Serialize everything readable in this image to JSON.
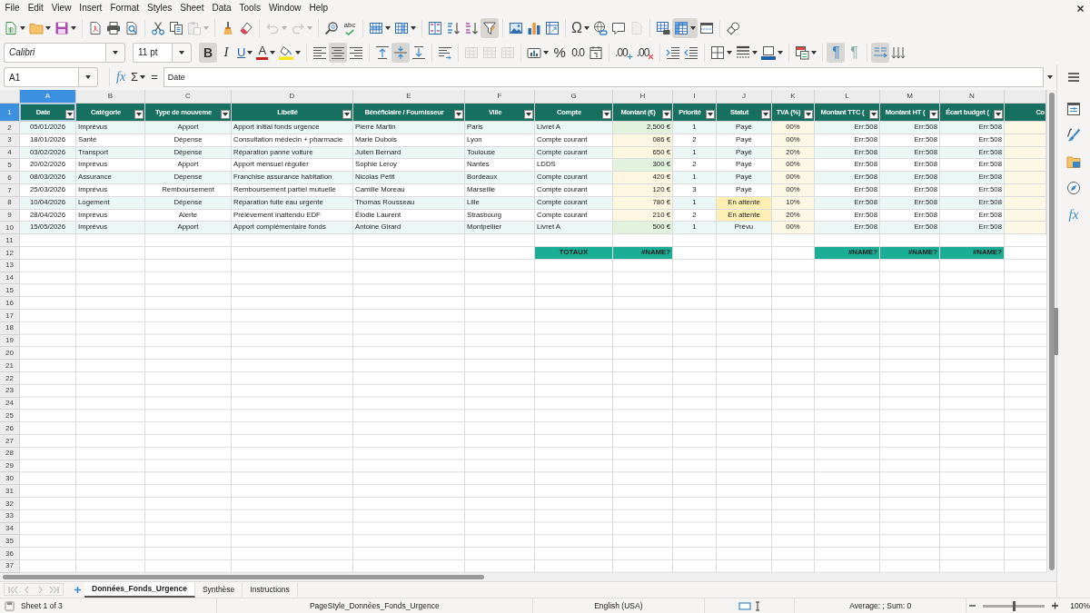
{
  "menu_bar": {
    "items": [
      "File",
      "Edit",
      "View",
      "Insert",
      "Format",
      "Styles",
      "Sheet",
      "Data",
      "Tools",
      "Window",
      "Help"
    ]
  },
  "standard_toolbar": {
    "buttons": [
      {
        "pressed": false,
        "disabled": false
      },
      {
        "pressed": false,
        "disabled": false
      },
      {
        "pressed": false,
        "disabled": false
      },
      {
        "pressed": false,
        "disabled": false
      },
      {
        "pressed": false,
        "disabled": false
      },
      {
        "pressed": false,
        "disabled": false
      },
      {
        "pressed": false,
        "disabled": false
      },
      {
        "pressed": false,
        "disabled": false
      },
      {
        "pressed": false,
        "disabled": true
      },
      {
        "pressed": false,
        "disabled": false
      },
      {
        "pressed": false,
        "disabled": false
      },
      {
        "pressed": false,
        "disabled": true
      },
      {
        "pressed": false,
        "disabled": true
      },
      {
        "pressed": false,
        "disabled": false
      },
      {
        "glyph": "abc",
        "pressed": false,
        "disabled": false
      },
      {
        "pressed": false,
        "disabled": false
      },
      {
        "pressed": false,
        "disabled": false
      },
      {
        "pressed": false,
        "disabled": false
      },
      {
        "pressed": false,
        "disabled": false
      },
      {
        "pressed": false,
        "disabled": false
      },
      {
        "pressed": true,
        "disabled": false
      },
      {
        "pressed": false,
        "disabled": false
      },
      {
        "pressed": false,
        "disabled": false
      },
      {
        "pressed": false,
        "disabled": false
      },
      {
        "glyph": "Ω",
        "pressed": false,
        "disabled": false
      },
      {
        "pressed": false,
        "disabled": false
      },
      {
        "pressed": false,
        "disabled": false
      },
      {
        "pressed": false,
        "disabled": true
      },
      {
        "pressed": false,
        "disabled": false
      },
      {
        "pressed": true,
        "disabled": false
      },
      {
        "pressed": false,
        "disabled": false
      },
      {
        "pressed": false,
        "disabled": false
      }
    ]
  },
  "formatting_toolbar": {
    "font_name": "Calibri",
    "font_size": "11 pt",
    "buttons": [
      {
        "glyph": "B",
        "pressed": true,
        "disabled": false
      },
      {
        "glyph": "I",
        "pressed": false,
        "disabled": false
      },
      {
        "glyph": "U",
        "pressed": false,
        "disabled": false
      },
      {
        "glyph": "A",
        "pressed": false,
        "disabled": false
      },
      {
        "pressed": false,
        "disabled": false
      },
      {
        "pressed": false,
        "disabled": false
      },
      {
        "pressed": true,
        "disabled": false
      },
      {
        "pressed": false,
        "disabled": false
      },
      {
        "pressed": false,
        "disabled": false
      },
      {
        "pressed": true,
        "disabled": false
      },
      {
        "pressed": false,
        "disabled": false
      },
      {
        "pressed": false,
        "disabled": false
      },
      {
        "pressed": false,
        "disabled": true
      },
      {
        "pressed": false,
        "disabled": true
      },
      {
        "pressed": false,
        "disabled": true
      },
      {
        "pressed": false,
        "disabled": false
      },
      {
        "glyph": "%",
        "pressed": false,
        "disabled": false
      },
      {
        "glyph": "0.0",
        "pressed": false,
        "disabled": false
      },
      {
        "pressed": false,
        "disabled": false
      },
      {
        "glyph": ".00",
        "pressed": false,
        "disabled": false
      },
      {
        "glyph": ".00",
        "pressed": false,
        "disabled": false
      },
      {
        "pressed": false,
        "disabled": false
      },
      {
        "pressed": false,
        "disabled": false
      },
      {
        "pressed": false,
        "disabled": false
      },
      {
        "pressed": false,
        "disabled": false
      },
      {
        "pressed": false,
        "disabled": false
      },
      {
        "pressed": false,
        "disabled": false
      },
      {
        "glyph": "¶",
        "pressed": true,
        "disabled": false
      },
      {
        "glyph": "¶",
        "pressed": false,
        "disabled": false
      },
      {
        "pressed": true,
        "disabled": false
      },
      {
        "pressed": false,
        "disabled": false
      }
    ]
  },
  "formula_bar": {
    "name_box": "A1",
    "function_wizard": "fx",
    "sum": "Σ",
    "equals": "=",
    "content": "Date"
  },
  "sheet": {
    "column_headers": [
      {
        "label": "A",
        "selected": true
      },
      {
        "label": "B",
        "selected": false
      },
      {
        "label": "C",
        "selected": false
      },
      {
        "label": "D",
        "selected": false
      },
      {
        "label": "E",
        "selected": false
      },
      {
        "label": "F",
        "selected": false
      },
      {
        "label": "G",
        "selected": false
      },
      {
        "label": "H",
        "selected": false
      },
      {
        "label": "I",
        "selected": false
      },
      {
        "label": "J",
        "selected": false
      },
      {
        "label": "K",
        "selected": false
      },
      {
        "label": "L",
        "selected": false
      },
      {
        "label": "M",
        "selected": false
      },
      {
        "label": "N",
        "selected": false
      }
    ],
    "row_headers": [
      {
        "label": "1",
        "selected": true
      },
      {
        "label": "2",
        "selected": false
      },
      {
        "label": "3",
        "selected": false
      },
      {
        "label": "4",
        "selected": false
      },
      {
        "label": "5",
        "selected": false
      },
      {
        "label": "6",
        "selected": false
      },
      {
        "label": "7",
        "selected": false
      },
      {
        "label": "8",
        "selected": false
      },
      {
        "label": "9",
        "selected": false
      },
      {
        "label": "10",
        "selected": false
      },
      {
        "label": "11",
        "selected": false
      },
      {
        "label": "12",
        "selected": false
      },
      {
        "label": "13",
        "selected": false
      },
      {
        "label": "14",
        "selected": false
      },
      {
        "label": "15",
        "selected": false
      },
      {
        "label": "16",
        "selected": false
      },
      {
        "label": "17",
        "selected": false
      },
      {
        "label": "18",
        "selected": false
      },
      {
        "label": "19",
        "selected": false
      },
      {
        "label": "20",
        "selected": false
      },
      {
        "label": "21",
        "selected": false
      },
      {
        "label": "22",
        "selected": false
      },
      {
        "label": "23",
        "selected": false
      },
      {
        "label": "24",
        "selected": false
      },
      {
        "label": "25",
        "selected": false
      },
      {
        "label": "26",
        "selected": false
      },
      {
        "label": "27",
        "selected": false
      },
      {
        "label": "28",
        "selected": false
      },
      {
        "label": "29",
        "selected": false
      },
      {
        "label": "30",
        "selected": false
      },
      {
        "label": "31",
        "selected": false
      },
      {
        "label": "32",
        "selected": false
      },
      {
        "label": "33",
        "selected": false
      },
      {
        "label": "34",
        "selected": false
      },
      {
        "label": "35",
        "selected": false
      },
      {
        "label": "36",
        "selected": false
      },
      {
        "label": "37",
        "selected": false
      }
    ],
    "header_cells": [
      {
        "text": "Date",
        "filter": true
      },
      {
        "text": "Catégorie",
        "filter": true
      },
      {
        "text": "Type de mouveme",
        "filter": true
      },
      {
        "text": "Libellé",
        "filter": true
      },
      {
        "text": "Bénéficiaire / Fournisseur",
        "filter": true
      },
      {
        "text": "Ville",
        "filter": true
      },
      {
        "text": "Compte",
        "filter": true
      },
      {
        "text": "Montant (€)",
        "filter": true
      },
      {
        "text": "Priorité",
        "filter": true
      },
      {
        "text": "Statut",
        "filter": true
      },
      {
        "text": "TVA (%)",
        "filter": true
      },
      {
        "text": "Montant TTC (",
        "filter": true
      },
      {
        "text": "Montant HT (",
        "filter": true
      },
      {
        "text": "Écart budget (",
        "filter": true
      },
      {
        "text": "Co",
        "filter": false
      }
    ],
    "data_rows": [
      {
        "cells": [
          "05/01/2026",
          "Imprévus",
          "Apport",
          "Apport initial fonds urgence",
          "Pierre Martin",
          "Paris",
          "Livret A",
          "2,500 €",
          "1",
          "Payé",
          "00%",
          "Err:508",
          "Err:508",
          "Err:508"
        ],
        "amount_highlight": {
          "color": "#e2f2dc"
        }
      },
      {
        "cells": [
          "18/01/2026",
          "Santé",
          "Dépense",
          "Consultation médecin + pharmacie",
          "Marie Dubois",
          "Lyon",
          "Compte courant",
          "086 €",
          "2",
          "Payé",
          "00%",
          "Err:508",
          "Err:508",
          "Err:508"
        ],
        "amount_highlight": {
          "color": "#fdf6e0"
        }
      },
      {
        "cells": [
          "03/02/2026",
          "Transport",
          "Dépense",
          "Réparation panne voiture",
          "Julien Bernard",
          "Toulouse",
          "Compte courant",
          "650 €",
          "1",
          "Payé",
          "20%",
          "Err:508",
          "Err:508",
          "Err:508"
        ],
        "amount_highlight": {
          "color": "#fdf6e0"
        }
      },
      {
        "cells": [
          "20/02/2026",
          "Imprévus",
          "Apport",
          "Apport mensuel régulier",
          "Sophie Leroy",
          "Nantes",
          "LDDS",
          "300 €",
          "2",
          "Payé",
          "00%",
          "Err:508",
          "Err:508",
          "Err:508"
        ],
        "amount_highlight": {
          "color": "#e2f2dc"
        }
      },
      {
        "cells": [
          "08/03/2026",
          "Assurance",
          "Dépense",
          "Franchise assurance habitation",
          "Nicolas Petit",
          "Bordeaux",
          "Compte courant",
          "420 €",
          "1",
          "Payé",
          "00%",
          "Err:508",
          "Err:508",
          "Err:508"
        ],
        "amount_highlight": {
          "color": "#fdf6e0"
        }
      },
      {
        "cells": [
          "25/03/2026",
          "Imprévus",
          "Remboursement",
          "Remboursement partiel mutuelle",
          "Camille Moreau",
          "Marseille",
          "Compte courant",
          "120 €",
          "3",
          "Payé",
          "00%",
          "Err:508",
          "Err:508",
          "Err:508"
        ],
        "amount_highlight": {
          "color": "#fdf6e0"
        }
      },
      {
        "cells": [
          "10/04/2026",
          "Logement",
          "Dépense",
          "Réparation fuite eau urgente",
          "Thomas Rousseau",
          "Lille",
          "Compte courant",
          "780 €",
          "1",
          "En attente",
          "10%",
          "Err:508",
          "Err:508",
          "Err:508"
        ],
        "amount_highlight": {
          "color": "#fdf6e0"
        },
        "status_highlight": {
          "color": "#fdeeb3"
        }
      },
      {
        "cells": [
          "28/04/2026",
          "Imprévus",
          "Alerte",
          "Prélèvement inattendu EDF",
          "Élodie Laurent",
          "Strasbourg",
          "Compte courant",
          "210 €",
          "2",
          "En attente",
          "20%",
          "Err:508",
          "Err:508",
          "Err:508"
        ],
        "amount_highlight": {
          "color": "#fdf6e0"
        },
        "status_highlight": {
          "color": "#fdeeb3"
        }
      },
      {
        "cells": [
          "15/05/2026",
          "Imprévus",
          "Apport",
          "Apport complémentaire fonds",
          "Antoine Girard",
          "Montpellier",
          "Livret A",
          "500 €",
          "1",
          "Prévu",
          "00%",
          "Err:508",
          "Err:508",
          "Err:508"
        ],
        "amount_highlight": {
          "color": "#e2f2dc"
        }
      }
    ],
    "totals": {
      "label": "TOTAUX",
      "amount": "#NAME?",
      "ttc": "#NAME?",
      "ht": "#NAME?",
      "budget_gap": "#NAME?"
    }
  },
  "sidebar": {
    "functions_glyph": "fx"
  },
  "sheet_tabs": [
    {
      "label": "Données_Fonds_Urgence",
      "selected": true
    },
    {
      "label": "Synthèse",
      "selected": false
    },
    {
      "label": "Instructions",
      "selected": false
    }
  ],
  "status_bar": {
    "sheet_position": "Sheet 1 of 3",
    "page_style": "PageStyle_Données_Fonds_Urgence",
    "language": "English (USA)",
    "selection_summary": "Average: ; Sum: 0",
    "zoom_slider": {
      "level": 0.5
    },
    "zoom": "100%"
  }
}
